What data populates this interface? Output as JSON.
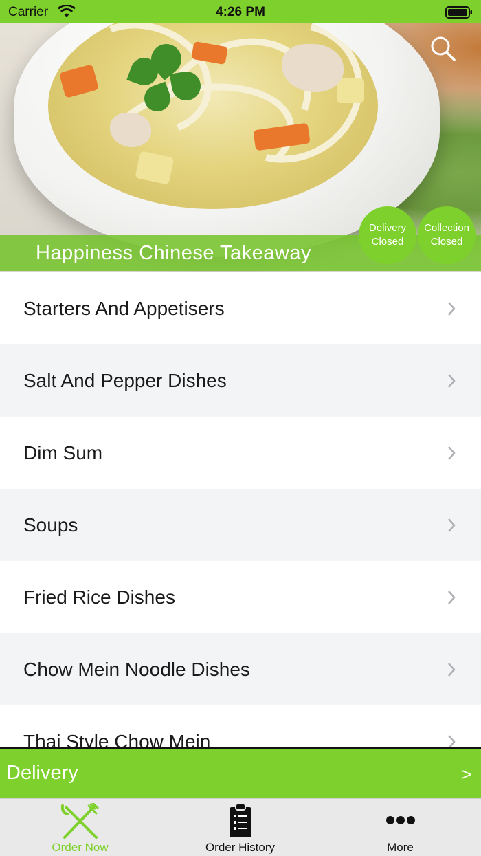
{
  "status_bar": {
    "carrier": "Carrier",
    "time": "4:26 PM"
  },
  "hero": {
    "restaurant_name": "Happiness Chinese Takeaway",
    "badges": [
      {
        "line1": "Delivery",
        "line2": "Closed"
      },
      {
        "line1": "Collection",
        "line2": "Closed"
      }
    ]
  },
  "categories": [
    {
      "label": "Starters And Appetisers"
    },
    {
      "label": "Salt And Pepper Dishes"
    },
    {
      "label": "Dim Sum"
    },
    {
      "label": "Soups"
    },
    {
      "label": "Fried Rice Dishes"
    },
    {
      "label": "Chow Mein Noodle Dishes"
    },
    {
      "label": "Thai Style Chow Mein"
    }
  ],
  "delivery_bar": {
    "label": "Delivery",
    "arrow": ">"
  },
  "tabs": [
    {
      "label": "Order Now",
      "icon": "fork-knife-icon",
      "active": true
    },
    {
      "label": "Order History",
      "icon": "clipboard-list-icon",
      "active": false
    },
    {
      "label": "More",
      "icon": "more-dots-icon",
      "active": false
    }
  ],
  "colors": {
    "accent": "#7ed12c",
    "row_alt": "#f3f4f6"
  }
}
